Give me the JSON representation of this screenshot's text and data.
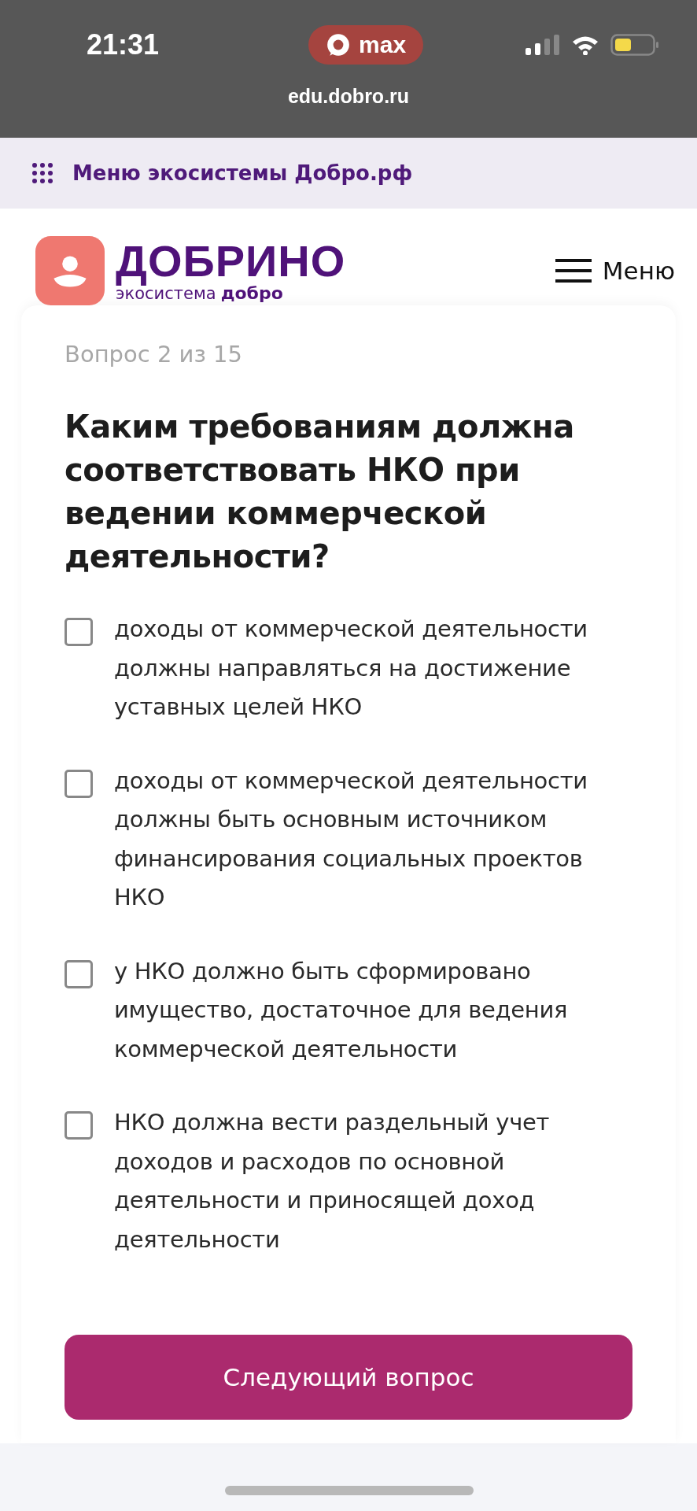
{
  "status_bar": {
    "time": "21:31",
    "app_pill": "max",
    "url": "edu.dobro.ru"
  },
  "eco_bar": {
    "label": "Меню экосистемы Добро.рф"
  },
  "header": {
    "logo_title": "ДОБРИНО",
    "logo_subtitle": "экосистема",
    "logo_brand": "добро",
    "menu_label": "Меню"
  },
  "quiz": {
    "counter": "Вопрос 2 из 15",
    "question": "Каким требованиям должна соответствовать НКО при ведении коммерческой деятельности?",
    "options": [
      {
        "label": "доходы от коммерческой деятельности должны направляться на достижение уставных целей НКО",
        "checked": false
      },
      {
        "label": "доходы от коммерческой деятельности должны быть основным источником финансирования социальных проектов НКО",
        "checked": false
      },
      {
        "label": "у НКО должно быть сформировано имущество, достаточное для ведения коммерческой деятельности",
        "checked": false
      },
      {
        "label": "НКО должна вести раздельный учет доходов и расходов по основной деятельности и приносящей доход деятельности",
        "checked": false
      }
    ],
    "next_button": "Следующий вопрос"
  }
}
